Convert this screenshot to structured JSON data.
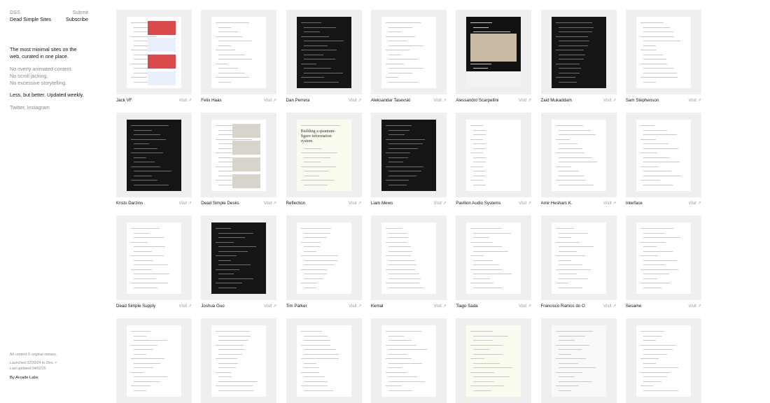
{
  "sidebar": {
    "brand_short": "DSS",
    "brand_full": "Dead Simple Sites",
    "submit": "Submit",
    "subscribe": "Subscribe",
    "tagline": "The most minimal sites on the web, curated in one place.",
    "nots": [
      "No overly animated content.",
      "No scroll jacking.",
      "No excessive storytelling."
    ],
    "better": "Less, but better. Updated weekly.",
    "social_twitter": "Twitter,",
    "social_instagram": "Instagram",
    "footer_owners": "All content © original owners.",
    "footer_launched": "Launched 02/20/24 to 2hrs ↗",
    "footer_updated": "Last updated 04/02/25",
    "footer_by": "By Arcade Labs"
  },
  "visit_label": "Visit ↗",
  "sites": [
    {
      "name": "Jack VF",
      "theme": "light"
    },
    {
      "name": "Felix Haas",
      "theme": "light"
    },
    {
      "name": "Dan Perrera",
      "theme": "dark"
    },
    {
      "name": "Aleksandar Tasevski",
      "theme": "light"
    },
    {
      "name": "Alessandro Scarpellini",
      "theme": "photo"
    },
    {
      "name": "Zaid Mukaddam",
      "theme": "dark"
    },
    {
      "name": "Sam Stephenson",
      "theme": "light"
    },
    {
      "name": "Krists Darzins",
      "theme": "dark"
    },
    {
      "name": "Dead Simple Desks",
      "theme": "light"
    },
    {
      "name": "Reflection",
      "theme": "cream"
    },
    {
      "name": "Liam Mews",
      "theme": "dark"
    },
    {
      "name": "Pavilion Audio Systems",
      "theme": "light"
    },
    {
      "name": "Amir Hesham K.",
      "theme": "light"
    },
    {
      "name": "Interface",
      "theme": "light"
    },
    {
      "name": "Dead Simple Supply",
      "theme": "light"
    },
    {
      "name": "Joshua Guo",
      "theme": "dark"
    },
    {
      "name": "Tim Parker",
      "theme": "light"
    },
    {
      "name": "Kemal",
      "theme": "light"
    },
    {
      "name": "Tiago Sada",
      "theme": "light"
    },
    {
      "name": "Francisco Ramos do Ó",
      "theme": "light"
    },
    {
      "name": "Sesame",
      "theme": "light"
    },
    {
      "name": "",
      "theme": "light"
    },
    {
      "name": "",
      "theme": "light"
    },
    {
      "name": "",
      "theme": "light"
    },
    {
      "name": "",
      "theme": "light"
    },
    {
      "name": "",
      "theme": "cream"
    },
    {
      "name": "",
      "theme": "paper"
    },
    {
      "name": "",
      "theme": "light"
    }
  ],
  "thumb_texts": {
    "reflection": "Building a quantum-figure information system"
  }
}
